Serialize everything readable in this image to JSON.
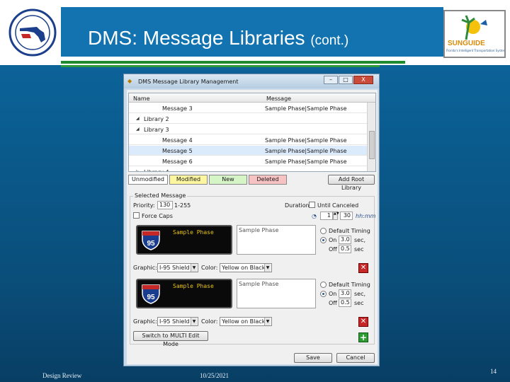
{
  "slide": {
    "title_main": "DMS: Message Libraries ",
    "title_small": "(cont.)",
    "footer_left": "Design Review",
    "footer_date": "10/25/2021",
    "page_number": "14",
    "sun_logo_text": "SUNGUIDE",
    "sun_logo_sub": "Florida's Intelligent Transportation System"
  },
  "window": {
    "title": "DMS Message Library Management",
    "btn_min": "–",
    "btn_max": "□",
    "btn_close": "X"
  },
  "grid": {
    "columns": [
      "Name",
      "Message"
    ],
    "rows": [
      {
        "name": "Message 3",
        "message": "Sample Phase|Sample Phase",
        "indent": 3,
        "toggle": ""
      },
      {
        "name": "Library 2",
        "message": "",
        "indent": 1,
        "toggle": "◢"
      },
      {
        "name": "Library 3",
        "message": "",
        "indent": 1,
        "toggle": "◢"
      },
      {
        "name": "Message 4",
        "message": "Sample Phase|Sample Phase",
        "indent": 3,
        "toggle": ""
      },
      {
        "name": "Message 5",
        "message": "Sample Phase|Sample Phase",
        "indent": 3,
        "toggle": "",
        "selected": true
      },
      {
        "name": "Message 6",
        "message": "Sample Phase|Sample Phase",
        "indent": 3,
        "toggle": ""
      },
      {
        "name": "Library 4",
        "message": "",
        "indent": 1,
        "toggle": "▷"
      }
    ]
  },
  "legend": {
    "unmodified": "Unmodified",
    "modified": "Modified",
    "new": "New",
    "deleted": "Deleted",
    "add_root": "Add Root Library"
  },
  "selected": {
    "group_label": "Selected Message",
    "priority_label": "Priority:",
    "priority_value": "130",
    "priority_range": "1-255",
    "duration_label": "Duration:",
    "until_canceled": "Until Canceled",
    "duration_h": "1",
    "duration_m": "30",
    "duration_unit": "hh:mm",
    "force_caps": "Force Caps"
  },
  "phase1": {
    "sign_text": "Sample Phase",
    "shield_number": "95",
    "text": "Sample Phase",
    "default_timing": "Default Timing",
    "on_label": "On",
    "on_value": "3.0",
    "on_unit": "sec,",
    "off_label": "Off",
    "off_value": "0.5",
    "off_unit": "sec",
    "graphic_label": "Graphic:",
    "graphic_value": "I-95 Shield",
    "color_label": "Color:",
    "color_value": "Yellow on Black",
    "delete_glyph": "✕"
  },
  "phase2": {
    "sign_text": "Sample Phase",
    "shield_number": "95",
    "text": "Sample Phase",
    "default_timing": "Default Timing",
    "on_label": "On",
    "on_value": "3.0",
    "on_unit": "sec,",
    "off_label": "Off",
    "off_value": "0.5",
    "off_unit": "sec",
    "graphic_label": "Graphic:",
    "graphic_value": "I-95 Shield",
    "color_label": "Color:",
    "color_value": "Yellow on Black",
    "delete_glyph": "✕"
  },
  "bottom": {
    "switch_label": "Switch to MULTI Edit Mode",
    "add_glyph": "+",
    "save": "Save",
    "cancel": "Cancel"
  },
  "colors": {
    "unmodified": "#ffffff",
    "modified": "#fdf6a0",
    "new": "#d6f5c6",
    "deleted": "#f6c2c2",
    "sign_text": "#e8c414"
  }
}
